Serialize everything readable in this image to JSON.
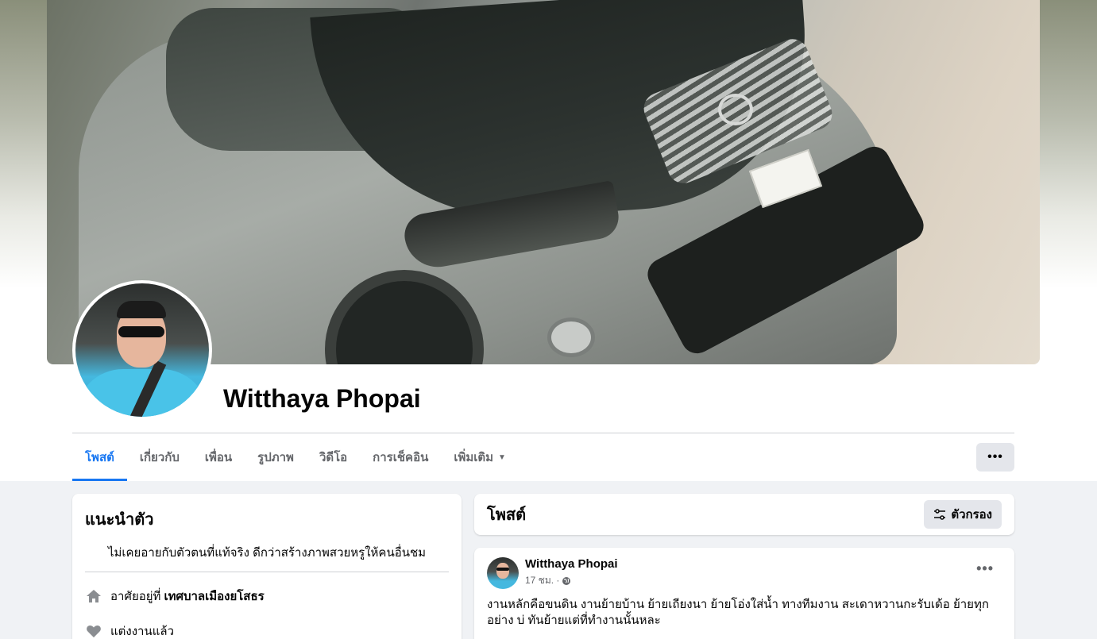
{
  "profile": {
    "name": "Witthaya Phopai"
  },
  "tabs": [
    {
      "label": "โพสต์"
    },
    {
      "label": "เกี่ยวกับ"
    },
    {
      "label": "เพื่อน"
    },
    {
      "label": "รูปภาพ"
    },
    {
      "label": "วิดีโอ"
    },
    {
      "label": "การเช็คอิน"
    },
    {
      "label": "เพิ่มเติม"
    }
  ],
  "more_button": {
    "label": "•••"
  },
  "intro": {
    "title": "แนะนำตัว",
    "bio": "ไม่เคยอายกับตัวตนที่แท้จริง ดีกว่าสร้างภาพสวยหรูให้คนอื่นชม",
    "location_prefix": "อาศัยอยู่ที่",
    "location": "เทศบาลเมืองยโสธร",
    "relationship": "แต่งงานแล้ว"
  },
  "posts_header": {
    "title": "โพสต์",
    "filter_label": "ตัวกรอง"
  },
  "post": {
    "author": "Witthaya Phopai",
    "time": "17 ชม. ·",
    "text": "งานหลักคือขนดิน งานย้ายบ้าน ย้ายเถียงนา ย้ายโอ่งใส่น้ำ ทางทีมงาน สะเดาหวานกะรับเด้อ ย้ายทุกอย่าง  บ่ ทันย้ายแต่ที่ทำงานนั้นหละ",
    "menu_label": "•••"
  },
  "colors": {
    "accent": "#1877f2",
    "page_bg": "#f0f2f5",
    "secondary_text": "#65676b"
  }
}
